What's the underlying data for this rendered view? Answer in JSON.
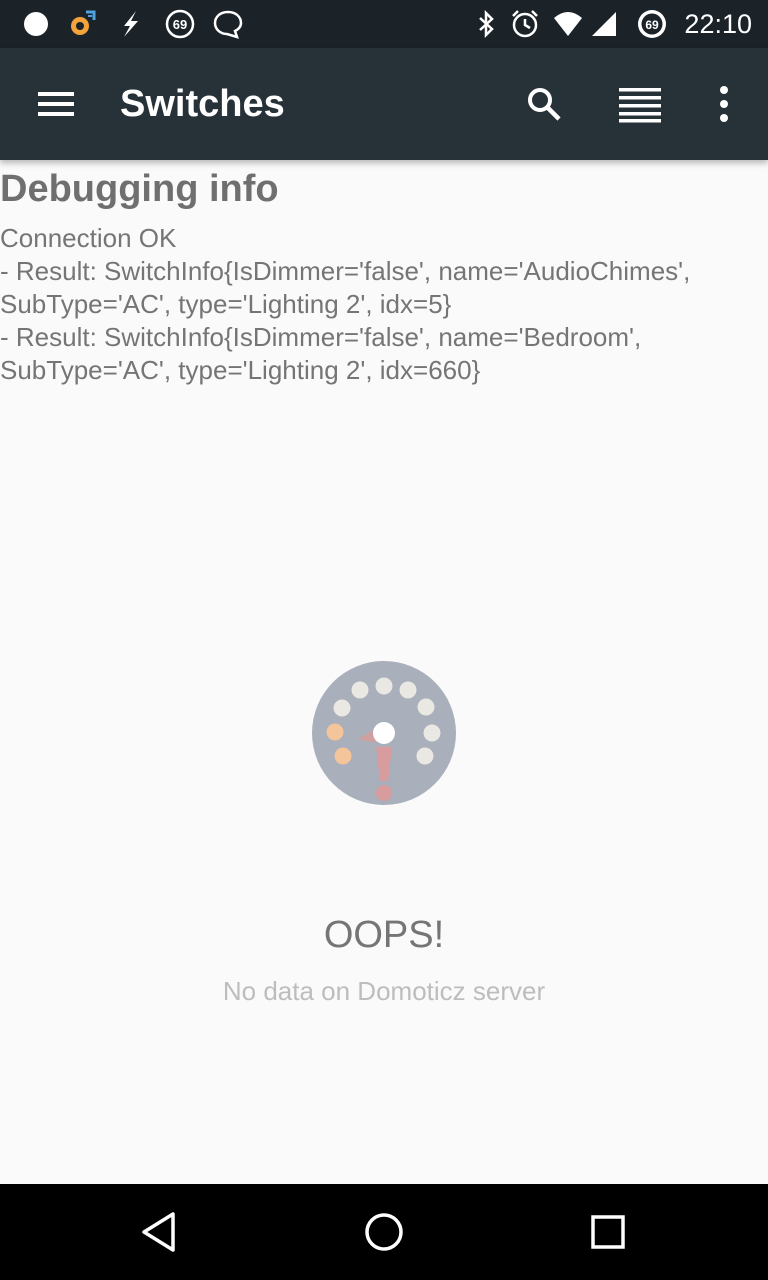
{
  "status_bar": {
    "time": "22:10",
    "notification_badge": "69",
    "battery_level": "69",
    "left_icons": [
      "moon-icon",
      "settings-alert-icon",
      "flash-icon",
      "badge-69-icon",
      "chat-icon"
    ],
    "right_icons": [
      "bluetooth-icon",
      "alarm-icon",
      "wifi-icon",
      "signal-icon",
      "battery-icon"
    ]
  },
  "app_bar": {
    "title": "Switches",
    "icons": [
      "menu-icon",
      "search-icon",
      "list-view-icon",
      "more-vert-icon"
    ]
  },
  "debug": {
    "title": "Debugging info",
    "lines": [
      "Connection OK",
      "- Result: SwitchInfo{IsDimmer='false', name='AudioChimes',",
      "SubType='AC', type='Lighting 2', idx=5}",
      "- Result: SwitchInfo{IsDimmer='false', name='Bedroom',",
      "SubType='AC', type='Lighting 2', idx=660}"
    ]
  },
  "empty_state": {
    "icon": "domoticz-error-icon",
    "title": "OOPS!",
    "message": "No data on Domoticz server"
  },
  "nav_bar": {
    "icons": [
      "back-icon",
      "home-icon",
      "recents-icon"
    ]
  },
  "colors": {
    "status_bar": "#1b2329",
    "app_bar": "#263238",
    "background": "#fafafa",
    "nav_bar": "#000000"
  }
}
